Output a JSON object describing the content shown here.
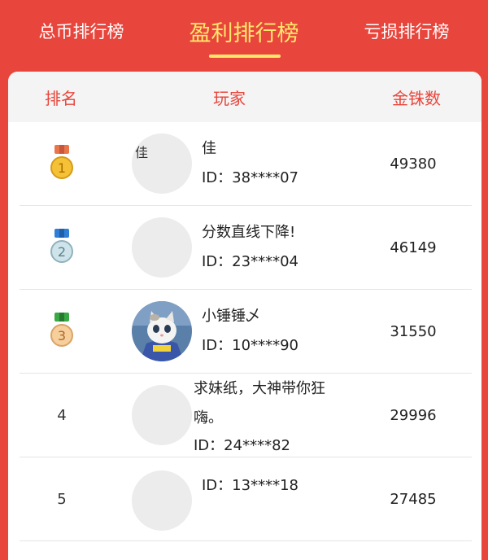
{
  "tabs": [
    {
      "label": "总币排行榜",
      "active": false
    },
    {
      "label": "盈利排行榜",
      "active": true
    },
    {
      "label": "亏损排行榜",
      "active": false
    }
  ],
  "colors": {
    "brand": "#e8463c",
    "active_tab": "#ffe86b"
  },
  "table": {
    "headers": {
      "rank": "排名",
      "player": "玩家",
      "score": "金铢数"
    },
    "rows": [
      {
        "rank": "1",
        "medal_icon": "gold-medal-icon",
        "avatar_text": "佳",
        "name": "佳",
        "id": "ID：38****07",
        "score": "49380"
      },
      {
        "rank": "2",
        "medal_icon": "silver-medal-icon",
        "name": "分数直线下降!",
        "id": "ID：23****04",
        "score": "46149"
      },
      {
        "rank": "3",
        "medal_icon": "bronze-medal-icon",
        "name": "小锤锤乄",
        "id": "ID：10****90",
        "score": "31550"
      },
      {
        "rank": "4",
        "name_line1": "求妹纸，大神带你狂",
        "name_line2": "嗨。",
        "id": "ID：24****82",
        "score": "29996"
      },
      {
        "rank": "5",
        "id": "ID：13****18",
        "score": "27485"
      }
    ]
  }
}
